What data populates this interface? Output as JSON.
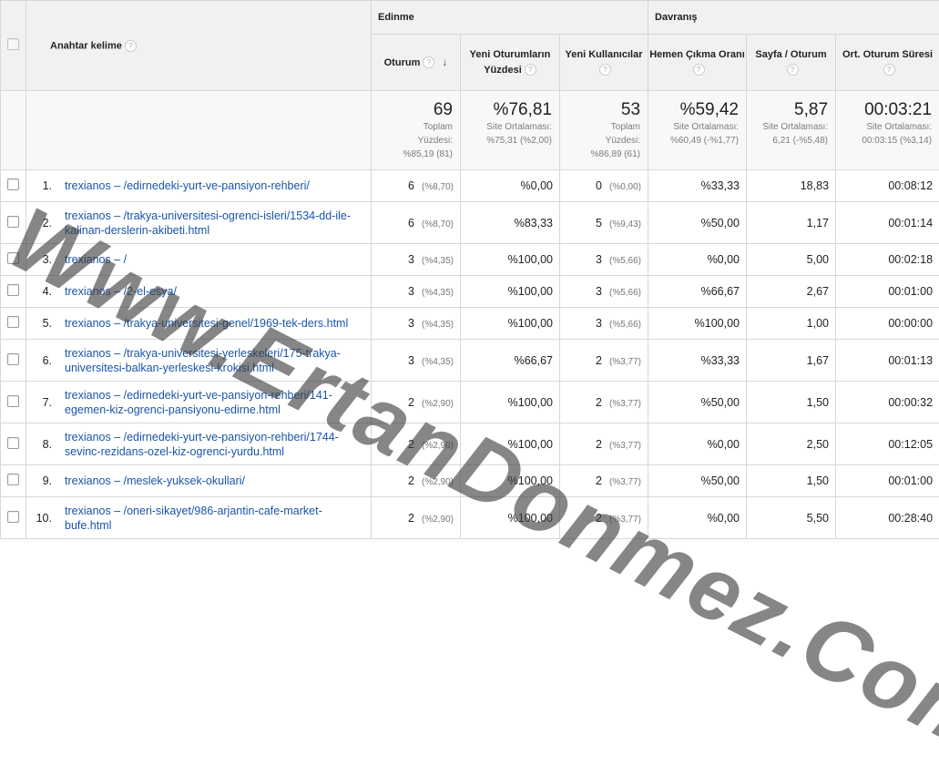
{
  "header": {
    "keyword_col": "Anahtar kelime",
    "groups": {
      "acquisition": "Edinme",
      "behavior": "Davranış"
    },
    "columns": [
      "Oturum",
      "Yeni Oturumların Yüzdesi",
      "Yeni Kullanıcılar",
      "Hemen Çıkma Oranı",
      "Sayfa / Oturum",
      "Ort. Oturum Süresi"
    ]
  },
  "totals": {
    "sessions": {
      "value": "69",
      "line1": "Toplam",
      "line2": "Yüzdesi:",
      "line3": "%85,19 (81)"
    },
    "new_sessions_pct": {
      "value": "%76,81",
      "line1": "Site Ortalaması:",
      "line2": "%75,31 (%2,00)"
    },
    "new_users": {
      "value": "53",
      "line1": "Toplam",
      "line2": "Yüzdesi:",
      "line3": "%86,89 (61)"
    },
    "bounce": {
      "value": "%59,42",
      "line1": "Site Ortalaması:",
      "line2": "%60,49 (-%1,77)"
    },
    "pages": {
      "value": "5,87",
      "line1": "Site Ortalaması:",
      "line2": "6,21 (-%5,48)"
    },
    "duration": {
      "value": "00:03:21",
      "line1": "Site Ortalaması:",
      "line2": "00:03:15 (%3,14)"
    }
  },
  "rows": [
    {
      "idx": "1.",
      "kw1": "trexianos – /edirnedeki-yurt-ve-pansiyon-rehberi/",
      "kw2": "",
      "sessions": "6",
      "sessions_pct": "(%8,70)",
      "new_pct": "%0,00",
      "new_users": "0",
      "new_users_pct": "(%0,00)",
      "bounce": "%33,33",
      "pages": "18,83",
      "duration": "00:08:12"
    },
    {
      "idx": "2.",
      "kw1": "trexianos – /trakya-universitesi-ogrenci-isleri/1534-dd-ile-",
      "kw2": "kalinan-derslerin-akibeti.html",
      "sessions": "6",
      "sessions_pct": "(%8,70)",
      "new_pct": "%83,33",
      "new_users": "5",
      "new_users_pct": "(%9,43)",
      "bounce": "%50,00",
      "pages": "1,17",
      "duration": "00:01:14"
    },
    {
      "idx": "3.",
      "kw1": "trexianos – /",
      "kw2": "",
      "sessions": "3",
      "sessions_pct": "(%4,35)",
      "new_pct": "%100,00",
      "new_users": "3",
      "new_users_pct": "(%5,66)",
      "bounce": "%0,00",
      "pages": "5,00",
      "duration": "00:02:18"
    },
    {
      "idx": "4.",
      "kw1": "trexianos – /2-el-esya/",
      "kw2": "",
      "sessions": "3",
      "sessions_pct": "(%4,35)",
      "new_pct": "%100,00",
      "new_users": "3",
      "new_users_pct": "(%5,66)",
      "bounce": "%66,67",
      "pages": "2,67",
      "duration": "00:01:00"
    },
    {
      "idx": "5.",
      "kw1": "trexianos – /trakya-universitesi-genel/1969-tek-ders.html",
      "kw2": "",
      "sessions": "3",
      "sessions_pct": "(%4,35)",
      "new_pct": "%100,00",
      "new_users": "3",
      "new_users_pct": "(%5,66)",
      "bounce": "%100,00",
      "pages": "1,00",
      "duration": "00:00:00"
    },
    {
      "idx": "6.",
      "kw1": "trexianos – /trakya-universitesi-yerleskeleri/175-trakya-",
      "kw2": "universitesi-balkan-yerleskesi-krokisi.html",
      "sessions": "3",
      "sessions_pct": "(%4,35)",
      "new_pct": "%66,67",
      "new_users": "2",
      "new_users_pct": "(%3,77)",
      "bounce": "%33,33",
      "pages": "1,67",
      "duration": "00:01:13"
    },
    {
      "idx": "7.",
      "kw1": "trexianos – /edirnedeki-yurt-ve-pansiyon-rehberi/141-",
      "kw2": "egemen-kiz-ogrenci-pansiyonu-edirne.html",
      "sessions": "2",
      "sessions_pct": "(%2,90)",
      "new_pct": "%100,00",
      "new_users": "2",
      "new_users_pct": "(%3,77)",
      "bounce": "%50,00",
      "pages": "1,50",
      "duration": "00:00:32"
    },
    {
      "idx": "8.",
      "kw1": "trexianos – /edirnedeki-yurt-ve-pansiyon-rehberi/1744-",
      "kw2": "sevinc-rezidans-ozel-kiz-ogrenci-yurdu.html",
      "sessions": "2",
      "sessions_pct": "(%2,90)",
      "new_pct": "%100,00",
      "new_users": "2",
      "new_users_pct": "(%3,77)",
      "bounce": "%0,00",
      "pages": "2,50",
      "duration": "00:12:05"
    },
    {
      "idx": "9.",
      "kw1": "trexianos – /meslek-yuksek-okullari/",
      "kw2": "",
      "sessions": "2",
      "sessions_pct": "(%2,90)",
      "new_pct": "%100,00",
      "new_users": "2",
      "new_users_pct": "(%3,77)",
      "bounce": "%50,00",
      "pages": "1,50",
      "duration": "00:01:00"
    },
    {
      "idx": "10.",
      "kw1": "trexianos – /oneri-sikayet/986-arjantin-cafe-market-",
      "kw2": "bufe.html",
      "sessions": "2",
      "sessions_pct": "(%2,90)",
      "new_pct": "%100,00",
      "new_users": "2",
      "new_users_pct": "(%3,77)",
      "bounce": "%0,00",
      "pages": "5,50",
      "duration": "00:28:40"
    }
  ],
  "watermark": "Www.ErtanDonmez.Com",
  "icons": {
    "help": "?",
    "sort_desc": "↓"
  }
}
